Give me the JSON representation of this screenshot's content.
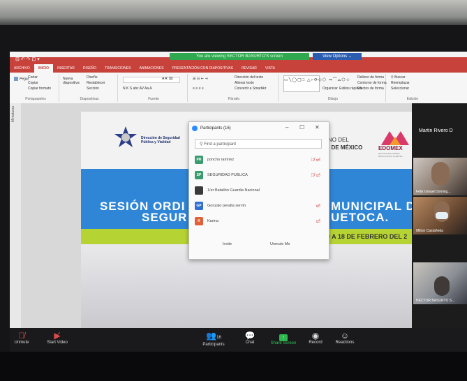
{
  "zoom": {
    "share_banner": "You are viewing SECTOR BASURTO'S screen",
    "view_options": "View Options ⌄",
    "controls": [
      {
        "label": "Unmute",
        "icon": "mic-muted-icon"
      },
      {
        "label": "Start Video",
        "icon": "video-off-icon"
      },
      {
        "label": "Participants",
        "icon": "participants-icon",
        "count": "16"
      },
      {
        "label": "Chat",
        "icon": "chat-icon",
        "badge": "1"
      },
      {
        "label": "Share Screen",
        "icon": "share-screen-icon"
      },
      {
        "label": "Record",
        "icon": "record-icon"
      },
      {
        "label": "Reactions",
        "icon": "reactions-icon"
      }
    ]
  },
  "ppt": {
    "quick_access": "⊟ ↶ ↷ ⊡ ▾",
    "tabs": [
      "ARCHIVO",
      "INICIO",
      "INSERTAR",
      "DISEÑO",
      "TRANSICIONES",
      "ANIMACIONES",
      "PRESENTACIÓN CON DIAPOSITIVAS",
      "REVISAR",
      "VISTA"
    ],
    "ribbon": {
      "portapapeles": {
        "label": "Portapapeles",
        "paste": "Pegar",
        "cut": "Cortar",
        "copy": "Copiar",
        "format": "Copiar formato"
      },
      "diapositivas": {
        "label": "Diapositivas",
        "new": "Nueva diapositiva",
        "layout": "Diseño",
        "reset": "Restablecer",
        "section": "Sección"
      },
      "fuente": {
        "label": "Fuente",
        "line1": "A A'  ⌧",
        "line2": "N K S abc AV Aa A"
      },
      "parrafo": {
        "label": "Párrafo",
        "dir": "Dirección del texto",
        "align": "Alinear texto",
        "smart": "Convertir a SmartArt"
      },
      "dibujo": {
        "label": "Dibujo",
        "arrange": "Organizar",
        "styles": "Estilos rápidos",
        "fill": "Relleno de forma",
        "outline": "Contorno de forma",
        "effects": "Efectos de forma"
      },
      "edicion": {
        "label": "Edición",
        "find": "Buscar",
        "replace": "Reemplazar",
        "select": "Seleccionar"
      }
    },
    "left_pane_label": "Miniaturas"
  },
  "slide": {
    "logo_text": "Dirección de Seguridad Pública y Vialidad",
    "gov_text_line1": "NO DEL",
    "gov_text_line2": "O DE MÉXICO",
    "edomex": "EDOMEX",
    "edomex_sub": "DECISIONES FIRMES, RESULTADOS FUERTES",
    "title_left_1": "SESIÓN ORDI",
    "title_left_2": "SEGUR",
    "title_right_1": "MUNICIPAL D",
    "title_right_2": "UETOCA.",
    "date": "O A 18 DE FEBRERO DEL 2"
  },
  "participants": {
    "title": "Participants (16)",
    "search_placeholder": "Find a participant",
    "list": [
      {
        "initials": "PR",
        "name": "poncho ramírez",
        "color": "#3a9c6e",
        "mic": "🎙̸ ▭̸"
      },
      {
        "initials": "SP",
        "name": "SEGURIDAD PUBLICA",
        "color": "#3a9c6e",
        "mic": "🎙̸ ▭̸"
      },
      {
        "initials": "",
        "name": "1/er Batallón Guardia Nacional",
        "color": "#3a3a3a",
        "mic": ""
      },
      {
        "initials": "GP",
        "name": "Gonzalo peralta servin",
        "color": "#2e6fd1",
        "mic": "▭̸"
      },
      {
        "initials": "K",
        "name": "Karina",
        "color": "#e0603a",
        "mic": "▭̸"
      }
    ],
    "invite": "Invite",
    "unmute_me": "Unmute Me"
  },
  "videos": {
    "top_name": "Martin Rivero D",
    "tiles": [
      {
        "name": "Félix Ismael Doming..."
      },
      {
        "name": "Milton Castañeda"
      },
      {
        "name": "HECTOR BASURTO S..."
      }
    ]
  }
}
